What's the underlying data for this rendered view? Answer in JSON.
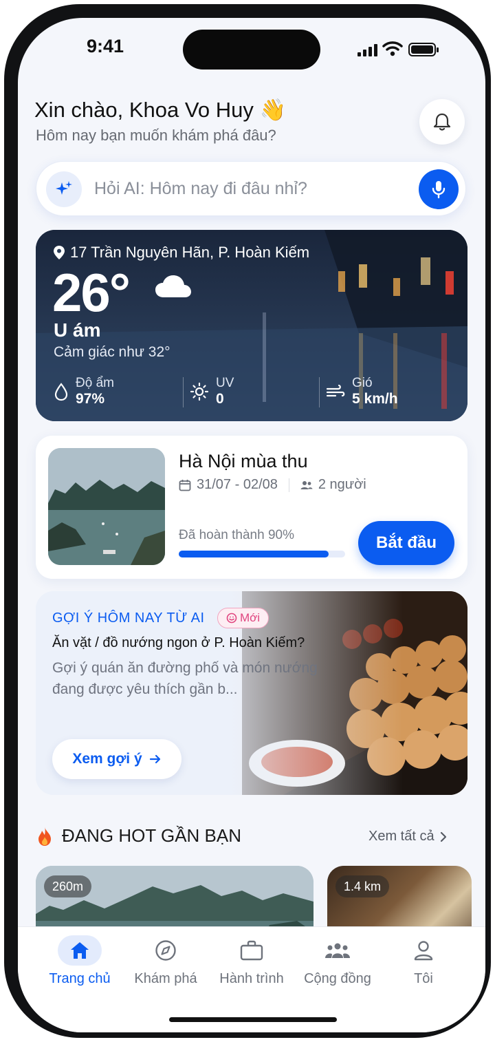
{
  "status_bar": {
    "time": "9:41"
  },
  "header": {
    "greeting": "Xin chào, Khoa Vo Huy 👋",
    "subtitle": "Hôm nay bạn muốn khám phá đâu?"
  },
  "search": {
    "placeholder": "Hỏi AI: Hôm nay đi đâu nhỉ?"
  },
  "weather": {
    "location": "17 Trần Nguyên Hãn, P. Hoàn Kiếm",
    "temperature": "26°",
    "condition": "U ám",
    "feels_like": "Cảm giác như 32°",
    "stats": [
      {
        "label": "Độ ẩm",
        "value": "97%",
        "icon": "droplet-icon"
      },
      {
        "label": "UV",
        "value": "0",
        "icon": "sun-icon"
      },
      {
        "label": "Gió",
        "value": "5 km/h",
        "icon": "wind-icon"
      }
    ]
  },
  "trip": {
    "title": "Hà Nội mùa thu",
    "dates": "31/07 - 02/08",
    "people": "2 người",
    "progress_label": "Đã hoàn thành 90%",
    "progress": 0.9,
    "action_label": "Bắt đầu"
  },
  "ai_suggestion": {
    "tag": "GỢI Ý HÔM NAY TỪ AI",
    "badge": "Mới",
    "question": "Ăn vặt / đồ nướng ngon ở P. Hoàn Kiếm?",
    "description": "Gợi ý quán ăn đường phố và món nướng đang được yêu thích gần b...",
    "button_label": "Xem gợi ý"
  },
  "hot_nearby": {
    "title": "ĐANG HOT GẦN BẠN",
    "see_all": "Xem tất cả",
    "cards": [
      {
        "distance": "260m"
      },
      {
        "distance": "1.4 km"
      }
    ]
  },
  "tab_bar": {
    "items": [
      {
        "label": "Trang chủ",
        "icon": "home-icon",
        "active": true
      },
      {
        "label": "Khám phá",
        "icon": "compass-icon",
        "active": false
      },
      {
        "label": "Hành trình",
        "icon": "briefcase-icon",
        "active": false
      },
      {
        "label": "Cộng đồng",
        "icon": "community-icon",
        "active": false
      },
      {
        "label": "Tôi",
        "icon": "user-icon",
        "active": false
      }
    ]
  },
  "colors": {
    "accent": "#0b5cf0",
    "new_badge": "#e0457f"
  }
}
